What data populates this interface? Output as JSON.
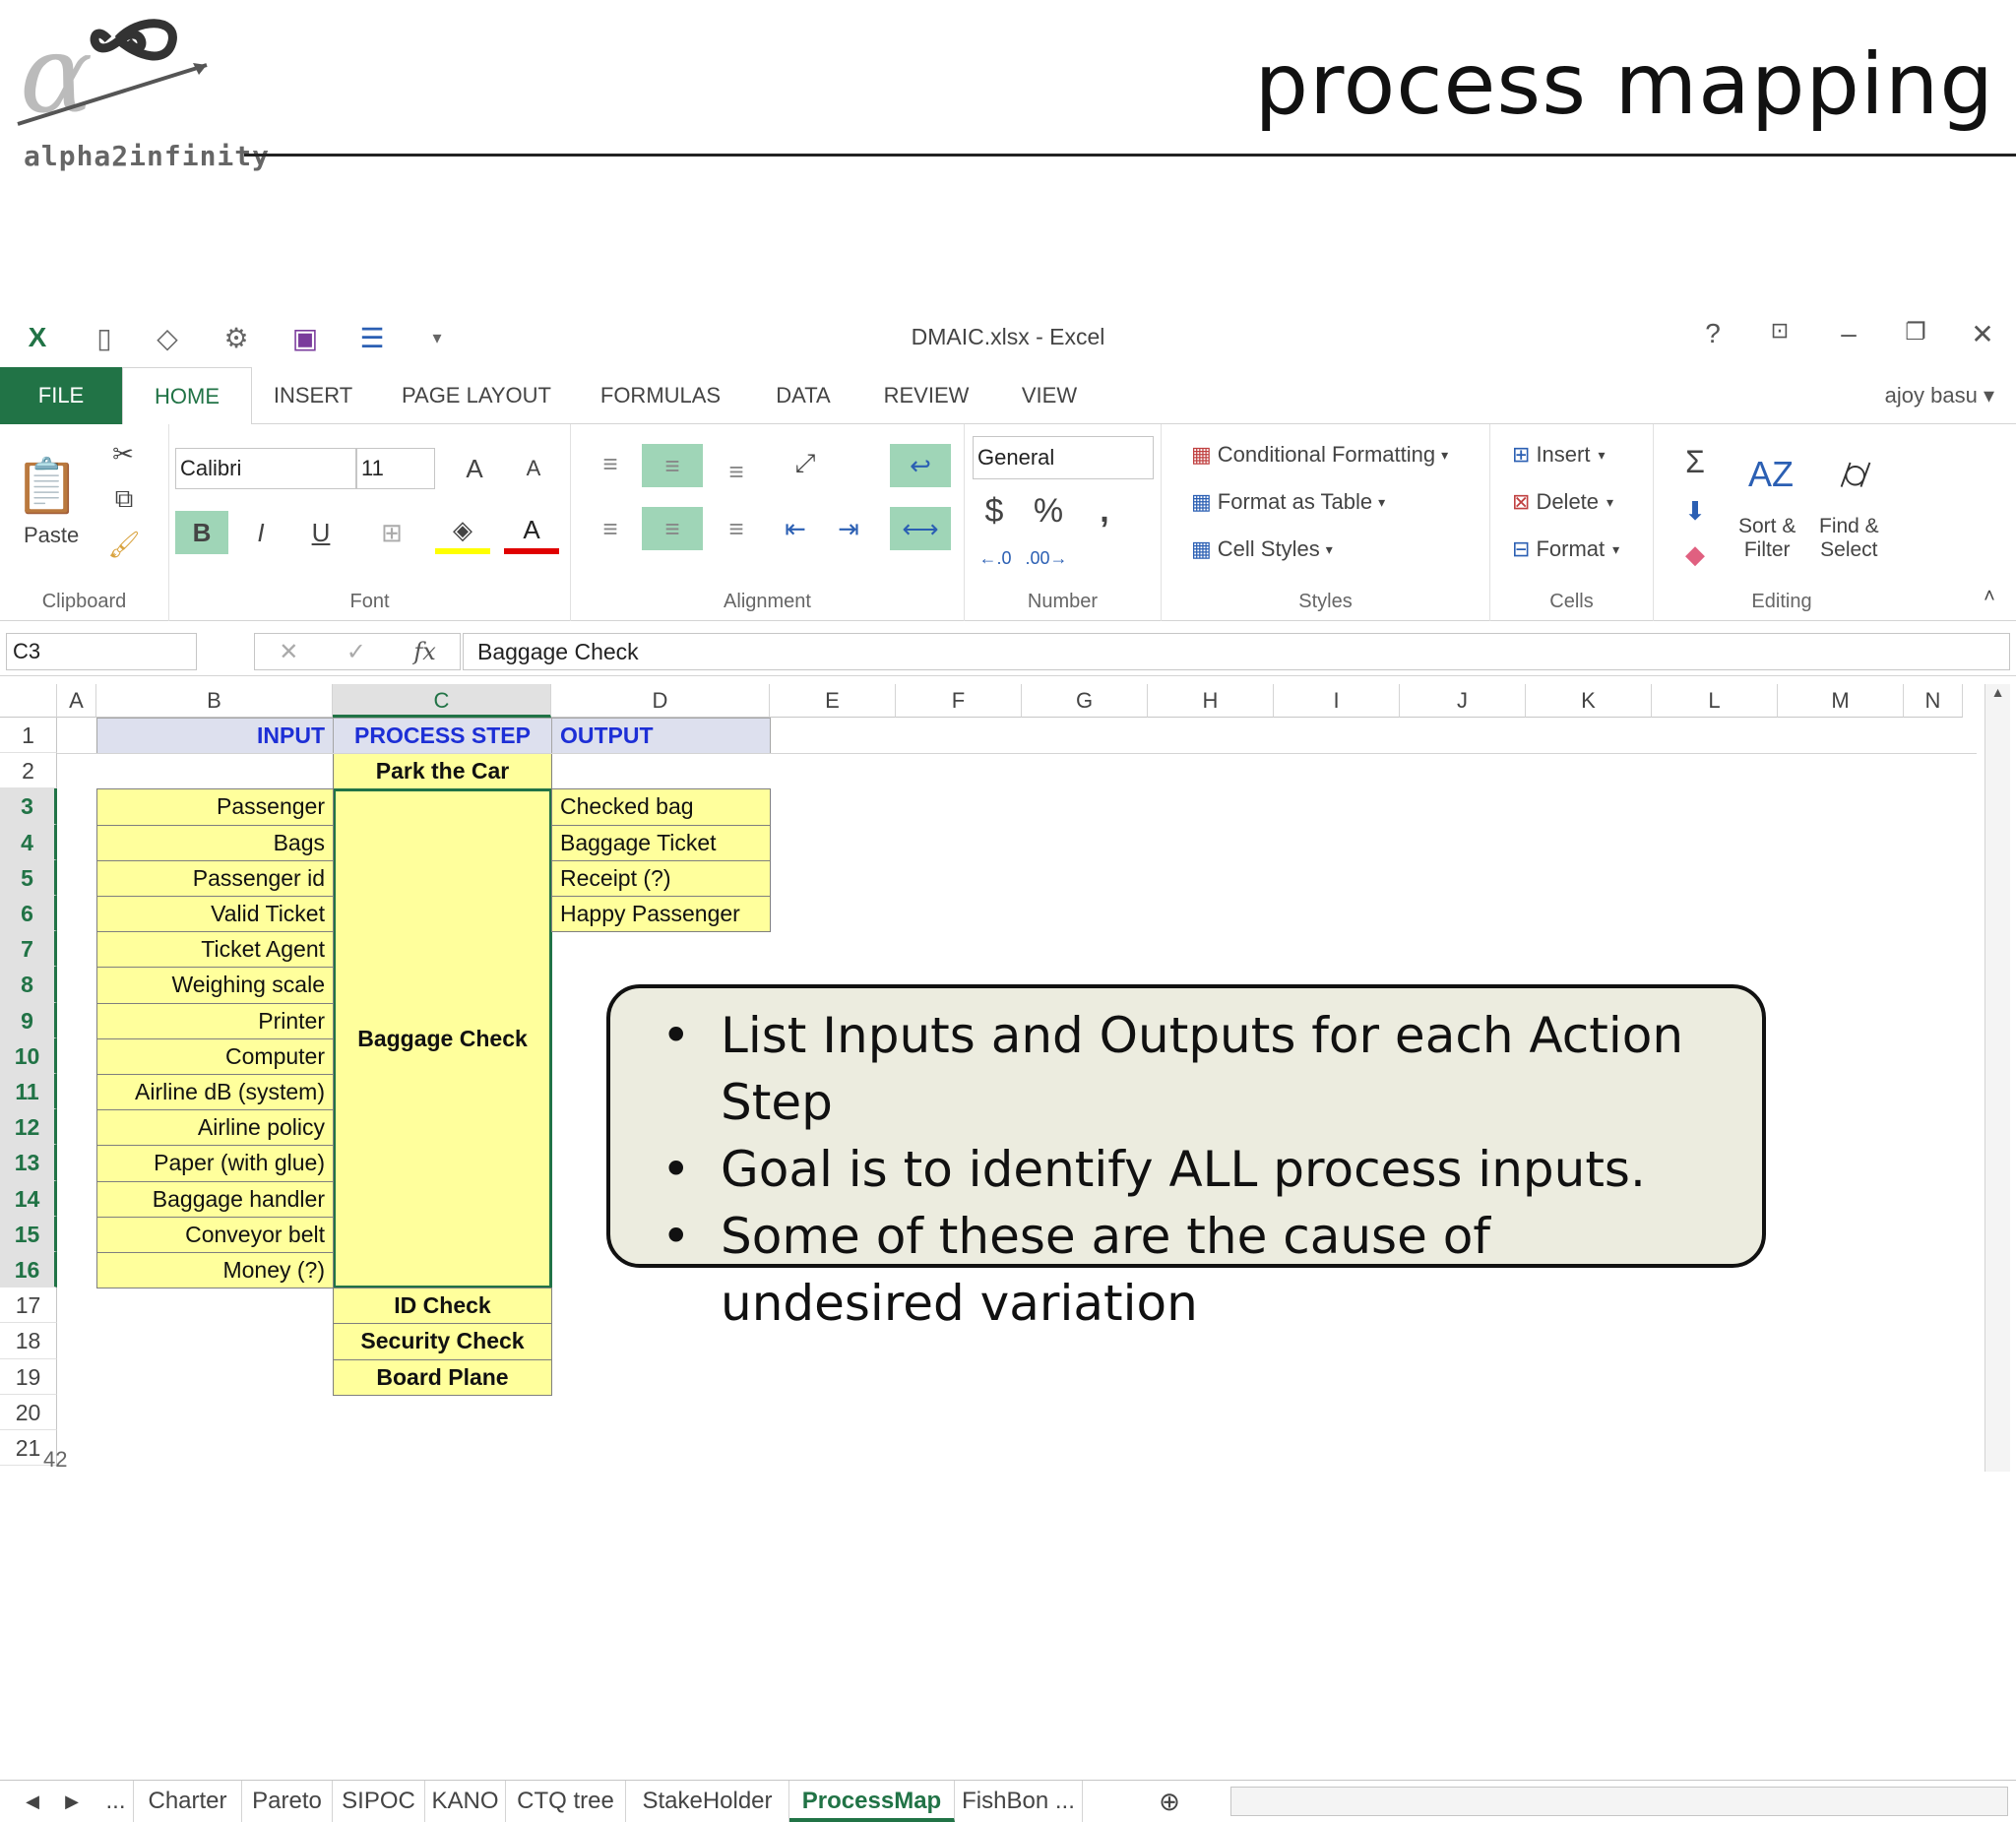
{
  "slide": {
    "title": "process mapping",
    "logo_text": "alpha2infinity"
  },
  "window": {
    "title": "DMAIC.xlsx - Excel",
    "help": "?",
    "user": "ajoy basu"
  },
  "ribbon_tabs": [
    "FILE",
    "HOME",
    "INSERT",
    "PAGE LAYOUT",
    "FORMULAS",
    "DATA",
    "REVIEW",
    "VIEW"
  ],
  "ribbon": {
    "clipboard": {
      "label": "Clipboard",
      "paste": "Paste"
    },
    "font": {
      "label": "Font",
      "name": "Calibri",
      "size": "11",
      "bold": "B",
      "italic": "I",
      "underline": "U"
    },
    "alignment": {
      "label": "Alignment"
    },
    "number": {
      "label": "Number",
      "format": "General",
      "currency": "$",
      "percent": "%",
      "comma": ","
    },
    "styles": {
      "label": "Styles",
      "conditional": "Conditional Formatting",
      "format_table": "Format as Table",
      "cell_styles": "Cell Styles"
    },
    "cells": {
      "label": "Cells",
      "insert": "Insert",
      "delete": "Delete",
      "format": "Format"
    },
    "editing": {
      "label": "Editing",
      "sort": "Sort &",
      "filter": "Filter",
      "find": "Find &",
      "select": "Select"
    }
  },
  "formula_bar": {
    "name_box": "C3",
    "fx": "fx",
    "value": "Baggage Check"
  },
  "columns": [
    "A",
    "B",
    "C",
    "D",
    "E",
    "F",
    "G",
    "H",
    "I",
    "J",
    "K",
    "L",
    "M",
    "N"
  ],
  "rows": [
    "1",
    "2",
    "3",
    "4",
    "5",
    "6",
    "7",
    "8",
    "9",
    "10",
    "11",
    "12",
    "13",
    "14",
    "15",
    "16",
    "17",
    "18",
    "19",
    "20",
    "21"
  ],
  "sheet": {
    "headers": {
      "input": "INPUT",
      "process": "PROCESS STEP",
      "output": "OUTPUT"
    },
    "inputs": [
      "Passenger",
      "Bags",
      "Passenger id",
      "Valid Ticket",
      "Ticket Agent",
      "Weighing scale",
      "Printer",
      "Computer",
      "Airline dB (system)",
      "Airline policy",
      "Paper (with glue)",
      "Baggage handler",
      "Conveyor belt",
      "Money (?)"
    ],
    "process_steps": {
      "first": "Park the Car",
      "main": "Baggage Check",
      "after": [
        "ID Check",
        "Security Check",
        "Board Plane"
      ]
    },
    "outputs": [
      "Checked bag",
      "Baggage Ticket",
      "Receipt (?)",
      "Happy Passenger"
    ]
  },
  "callout": {
    "bullet": "•",
    "items": [
      "List Inputs and Outputs for each Action Step",
      "Goal is to identify ALL process inputs.",
      "Some of these are the cause of undesired variation"
    ]
  },
  "slide_number": "42",
  "sheet_tabs": [
    "...",
    "Charter",
    "Pareto",
    "SIPOC",
    "KANO",
    "CTQ tree",
    "StakeHolder",
    "ProcessMap",
    "FishBon ..."
  ],
  "active_sheet": "ProcessMap"
}
